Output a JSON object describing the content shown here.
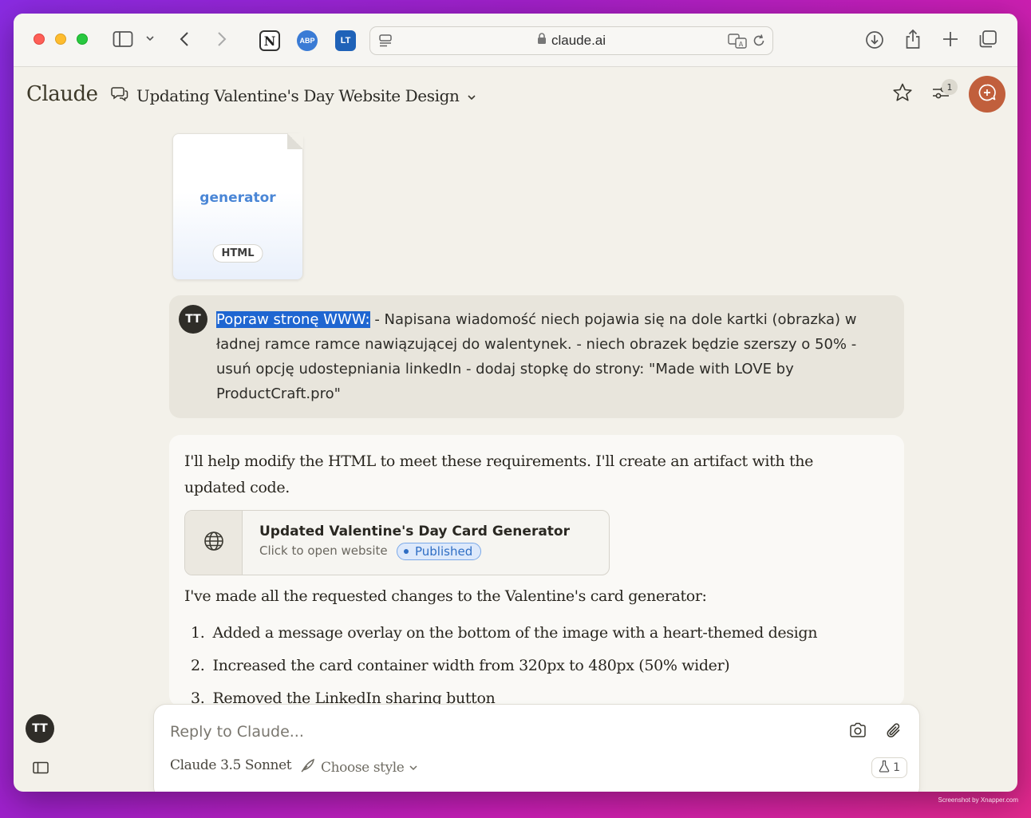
{
  "browser": {
    "url": "claude.ai",
    "extensions": [
      "N",
      "ABP",
      "LT"
    ]
  },
  "app": {
    "brand": "Claude",
    "conversation_title": "Updating Valentine's Day Website Design",
    "notification_count": "1"
  },
  "file_attachment": {
    "name": "generator",
    "type": "HTML"
  },
  "user_message": {
    "avatar_initials": "TT",
    "highlighted": "Popraw stronę WWW:",
    "text": " - Napisana wiadomość niech pojawia się na dole kartki (obrazka) w ładnej ramce ramce nawiązującej do walentynek. - niech obrazek będzie szerszy o 50% - usuń opcję udostepniania linkedIn - dodaj stopkę do strony: \"Made with LOVE by ProductCraft.pro\""
  },
  "assistant_message": {
    "intro": "I'll help modify the HTML to meet these requirements. I'll create an artifact with the updated code.",
    "artifact": {
      "title": "Updated Valentine's Day Card Generator",
      "subtitle": "Click to open website",
      "status": "Published"
    },
    "summary": "I've made all the requested changes to the Valentine's card generator:",
    "list": [
      {
        "num": "1.",
        "text": "Added a message overlay on the bottom of the image with a heart-themed design"
      },
      {
        "num": "2.",
        "text": "Increased the card container width from 320px to 480px (50% wider)"
      },
      {
        "num": "3.",
        "text": "Removed the LinkedIn sharing button"
      }
    ]
  },
  "composer": {
    "placeholder": "Reply to Claude...",
    "model": "Claude 3.5 Sonnet",
    "style_label": "Choose style",
    "flask_count": "1"
  },
  "sidebar": {
    "avatar_initials": "TT"
  },
  "watermark": "Screenshot by Xnapper.com",
  "colors": {
    "accent": "#c15f3c",
    "highlight": "#1f66d1",
    "published": "#2f6ec4"
  }
}
